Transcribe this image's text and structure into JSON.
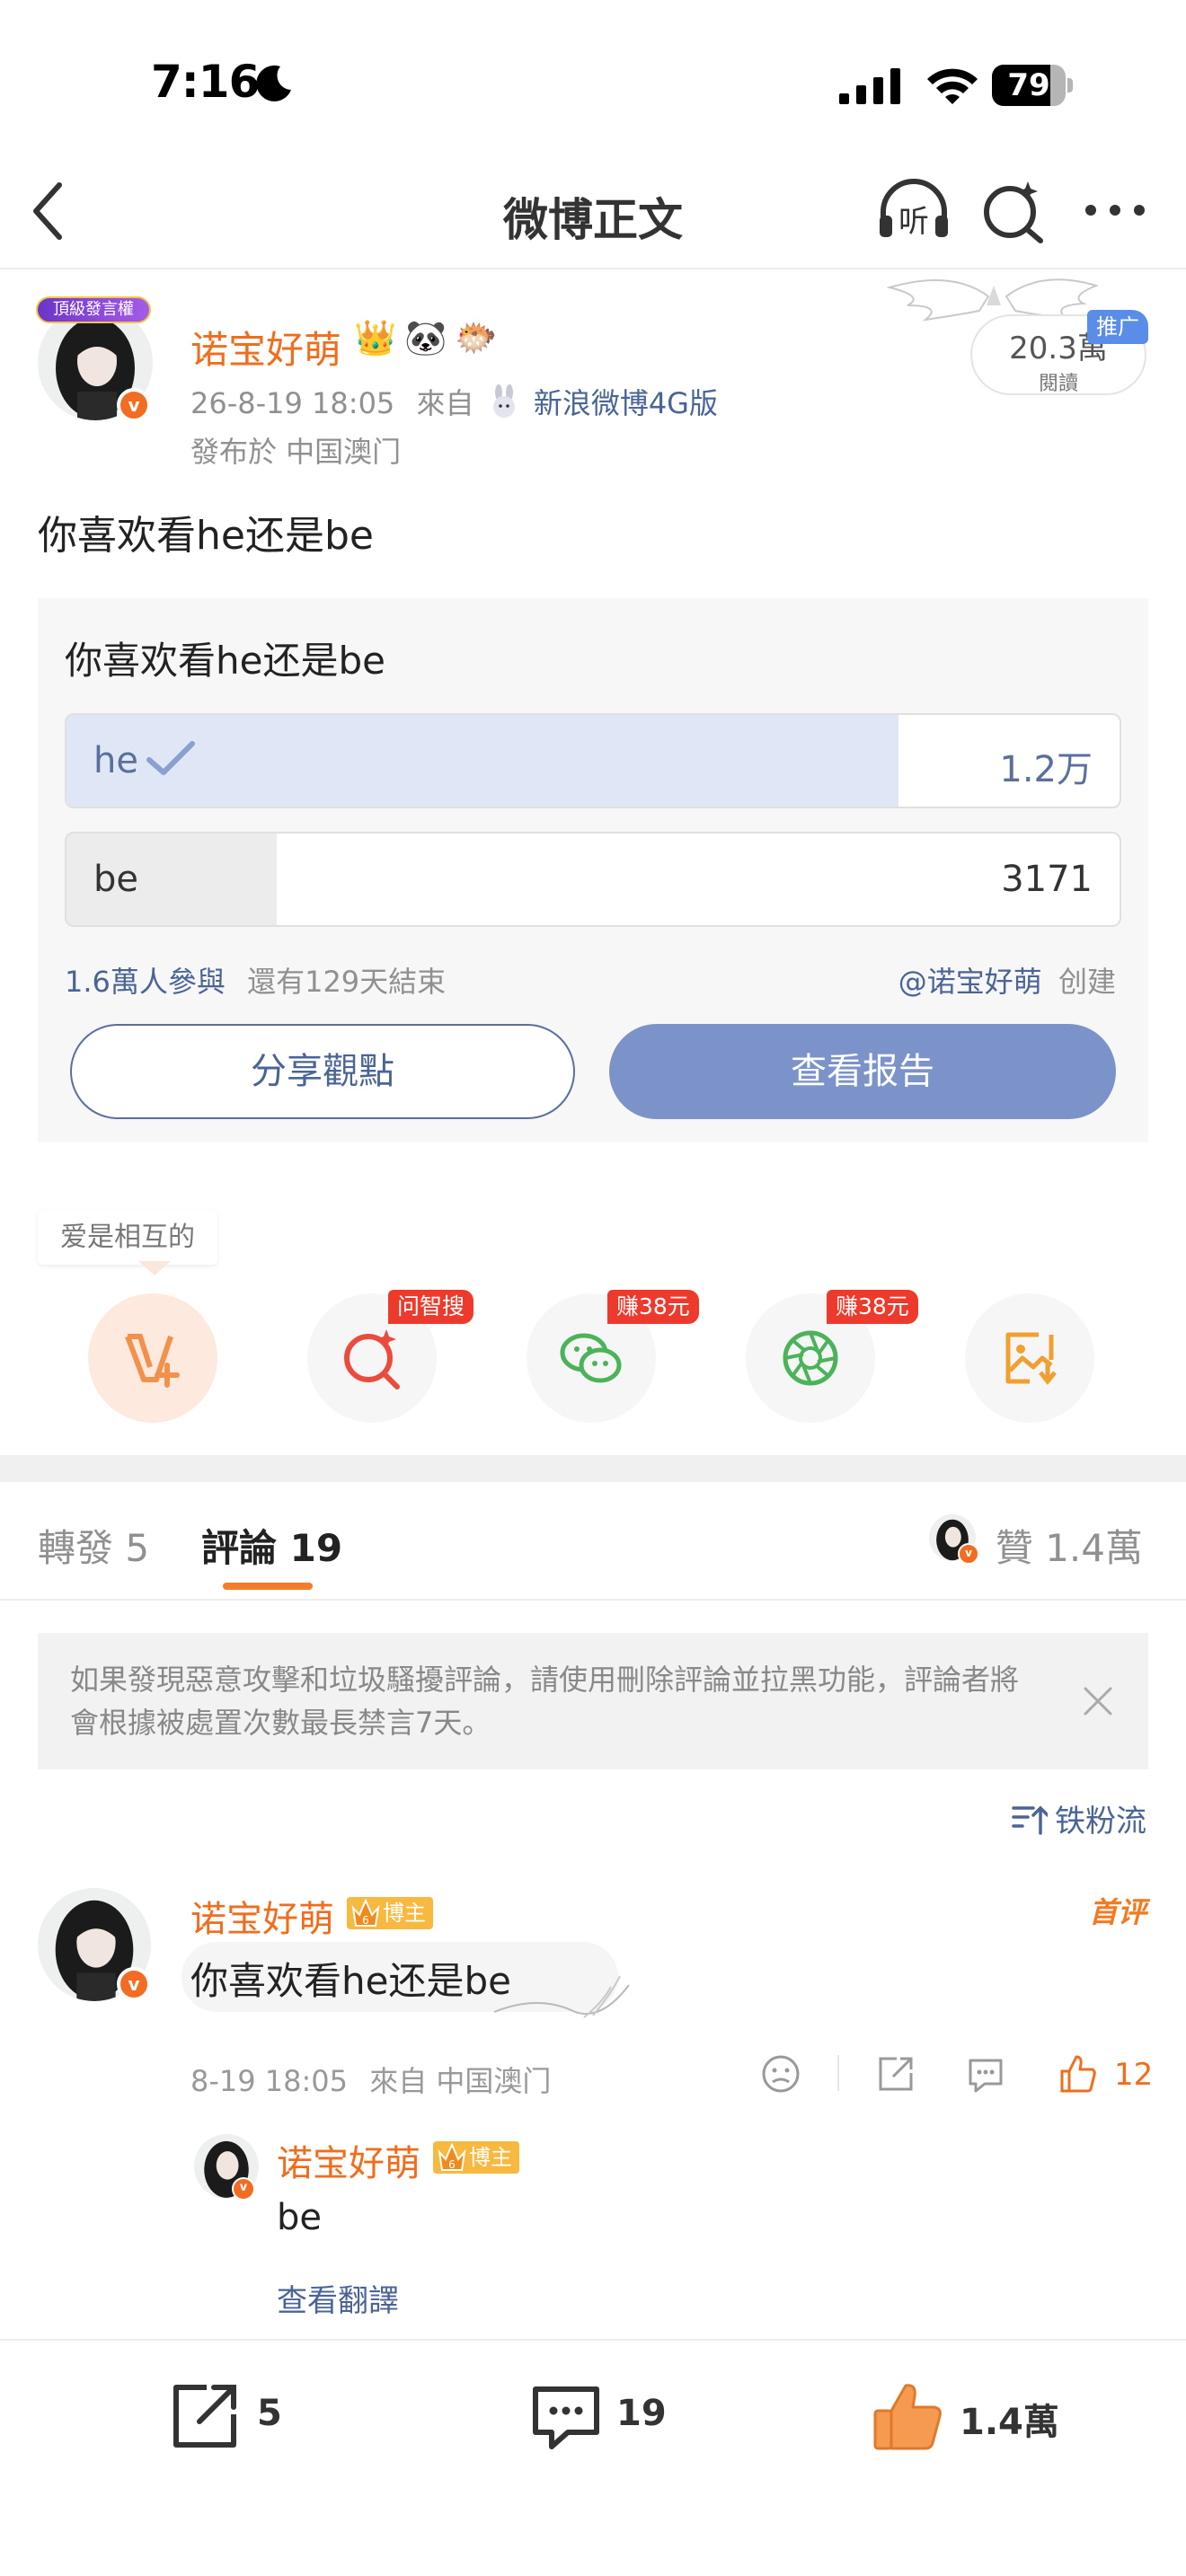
{
  "status_bar": {
    "time": "7:16",
    "battery": "79",
    "battery_level": 0.79
  },
  "nav": {
    "title": "微博正文",
    "icons": [
      "back-icon",
      "listen-icon",
      "ai-search-icon",
      "more-icon"
    ],
    "listen_label": "听"
  },
  "post": {
    "avatar_tag": "頂級發言權",
    "author": "诺宝好萌",
    "emojis": [
      "👑",
      "🐼",
      "🐡"
    ],
    "time": "26-8-19 18:05",
    "from_prefix": "來自",
    "client": "新浪微博4G版",
    "location": "發布於 中国澳门",
    "reads": "20.3萬",
    "reads_label": "閱讀",
    "promo": "推广",
    "text": "你喜欢看he还是be"
  },
  "poll": {
    "question": "你喜欢看he还是be",
    "options": [
      {
        "label": "he",
        "count": "1.2万",
        "share": 0.79,
        "selected": true
      },
      {
        "label": "be",
        "count": "3171",
        "share": 0.2,
        "selected": false
      }
    ],
    "participants": "1.6萬人參與",
    "remaining": "還有129天結束",
    "creator": "@诺宝好萌",
    "created": "创建",
    "share_button": "分享觀點",
    "report_button": "查看报告"
  },
  "share_row": {
    "hint": "爱是相互的",
    "buttons": [
      {
        "icon": "vplus-icon",
        "badge": ""
      },
      {
        "icon": "ai-search-icon",
        "badge": "问智搜"
      },
      {
        "icon": "wechat-icon",
        "badge": "赚38元"
      },
      {
        "icon": "moments-icon",
        "badge": "赚38元"
      },
      {
        "icon": "save-image-icon",
        "badge": ""
      }
    ]
  },
  "tabs": {
    "repost": "轉發 5",
    "comment": "評論 19",
    "likes": "贊 1.4萬"
  },
  "notice": {
    "text": "如果發現惡意攻擊和垃圾騷擾評論，請使用刪除評論並拉黑功能，評論者將會根據被處置次數最長禁言7天。"
  },
  "sort": {
    "label": "铁粉流"
  },
  "comments": [
    {
      "author": "诺宝好萌",
      "badge": "博主",
      "tag": "首评",
      "text": "你喜欢看he还是be",
      "time": "8-19 18:05",
      "from": "來自 中国澳门",
      "likes": "12",
      "reply": {
        "author": "诺宝好萌",
        "badge": "博主",
        "text": "be",
        "translate": "查看翻譯"
      }
    }
  ],
  "bottom_bar": {
    "repost_count": "5",
    "comment_count": "19",
    "like_count": "1.4萬"
  },
  "colors": {
    "accent": "#f06d1e",
    "link": "#4b6496",
    "poll_button": "#7b93c9",
    "badge_red": "#ee3a2c"
  }
}
